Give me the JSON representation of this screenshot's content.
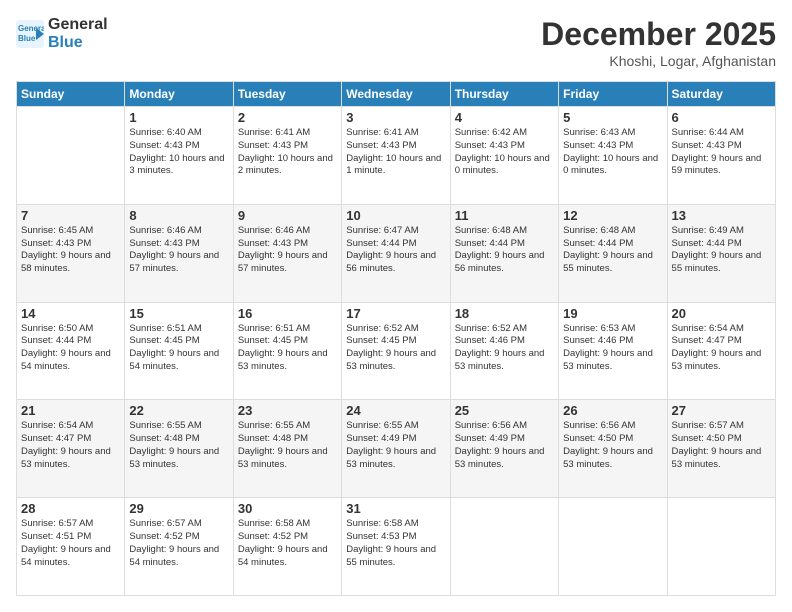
{
  "header": {
    "logo_line1": "General",
    "logo_line2": "Blue",
    "month_title": "December 2025",
    "location": "Khoshi, Logar, Afghanistan"
  },
  "days_of_week": [
    "Sunday",
    "Monday",
    "Tuesday",
    "Wednesday",
    "Thursday",
    "Friday",
    "Saturday"
  ],
  "weeks": [
    [
      {
        "day": "",
        "sunrise": "",
        "sunset": "",
        "daylight": ""
      },
      {
        "day": "1",
        "sunrise": "6:40 AM",
        "sunset": "4:43 PM",
        "daylight": "10 hours and 3 minutes."
      },
      {
        "day": "2",
        "sunrise": "6:41 AM",
        "sunset": "4:43 PM",
        "daylight": "10 hours and 2 minutes."
      },
      {
        "day": "3",
        "sunrise": "6:41 AM",
        "sunset": "4:43 PM",
        "daylight": "10 hours and 1 minute."
      },
      {
        "day": "4",
        "sunrise": "6:42 AM",
        "sunset": "4:43 PM",
        "daylight": "10 hours and 0 minutes."
      },
      {
        "day": "5",
        "sunrise": "6:43 AM",
        "sunset": "4:43 PM",
        "daylight": "10 hours and 0 minutes."
      },
      {
        "day": "6",
        "sunrise": "6:44 AM",
        "sunset": "4:43 PM",
        "daylight": "9 hours and 59 minutes."
      }
    ],
    [
      {
        "day": "7",
        "sunrise": "6:45 AM",
        "sunset": "4:43 PM",
        "daylight": "9 hours and 58 minutes."
      },
      {
        "day": "8",
        "sunrise": "6:46 AM",
        "sunset": "4:43 PM",
        "daylight": "9 hours and 57 minutes."
      },
      {
        "day": "9",
        "sunrise": "6:46 AM",
        "sunset": "4:43 PM",
        "daylight": "9 hours and 57 minutes."
      },
      {
        "day": "10",
        "sunrise": "6:47 AM",
        "sunset": "4:44 PM",
        "daylight": "9 hours and 56 minutes."
      },
      {
        "day": "11",
        "sunrise": "6:48 AM",
        "sunset": "4:44 PM",
        "daylight": "9 hours and 56 minutes."
      },
      {
        "day": "12",
        "sunrise": "6:48 AM",
        "sunset": "4:44 PM",
        "daylight": "9 hours and 55 minutes."
      },
      {
        "day": "13",
        "sunrise": "6:49 AM",
        "sunset": "4:44 PM",
        "daylight": "9 hours and 55 minutes."
      }
    ],
    [
      {
        "day": "14",
        "sunrise": "6:50 AM",
        "sunset": "4:44 PM",
        "daylight": "9 hours and 54 minutes."
      },
      {
        "day": "15",
        "sunrise": "6:51 AM",
        "sunset": "4:45 PM",
        "daylight": "9 hours and 54 minutes."
      },
      {
        "day": "16",
        "sunrise": "6:51 AM",
        "sunset": "4:45 PM",
        "daylight": "9 hours and 53 minutes."
      },
      {
        "day": "17",
        "sunrise": "6:52 AM",
        "sunset": "4:45 PM",
        "daylight": "9 hours and 53 minutes."
      },
      {
        "day": "18",
        "sunrise": "6:52 AM",
        "sunset": "4:46 PM",
        "daylight": "9 hours and 53 minutes."
      },
      {
        "day": "19",
        "sunrise": "6:53 AM",
        "sunset": "4:46 PM",
        "daylight": "9 hours and 53 minutes."
      },
      {
        "day": "20",
        "sunrise": "6:54 AM",
        "sunset": "4:47 PM",
        "daylight": "9 hours and 53 minutes."
      }
    ],
    [
      {
        "day": "21",
        "sunrise": "6:54 AM",
        "sunset": "4:47 PM",
        "daylight": "9 hours and 53 minutes."
      },
      {
        "day": "22",
        "sunrise": "6:55 AM",
        "sunset": "4:48 PM",
        "daylight": "9 hours and 53 minutes."
      },
      {
        "day": "23",
        "sunrise": "6:55 AM",
        "sunset": "4:48 PM",
        "daylight": "9 hours and 53 minutes."
      },
      {
        "day": "24",
        "sunrise": "6:55 AM",
        "sunset": "4:49 PM",
        "daylight": "9 hours and 53 minutes."
      },
      {
        "day": "25",
        "sunrise": "6:56 AM",
        "sunset": "4:49 PM",
        "daylight": "9 hours and 53 minutes."
      },
      {
        "day": "26",
        "sunrise": "6:56 AM",
        "sunset": "4:50 PM",
        "daylight": "9 hours and 53 minutes."
      },
      {
        "day": "27",
        "sunrise": "6:57 AM",
        "sunset": "4:50 PM",
        "daylight": "9 hours and 53 minutes."
      }
    ],
    [
      {
        "day": "28",
        "sunrise": "6:57 AM",
        "sunset": "4:51 PM",
        "daylight": "9 hours and 54 minutes."
      },
      {
        "day": "29",
        "sunrise": "6:57 AM",
        "sunset": "4:52 PM",
        "daylight": "9 hours and 54 minutes."
      },
      {
        "day": "30",
        "sunrise": "6:58 AM",
        "sunset": "4:52 PM",
        "daylight": "9 hours and 54 minutes."
      },
      {
        "day": "31",
        "sunrise": "6:58 AM",
        "sunset": "4:53 PM",
        "daylight": "9 hours and 55 minutes."
      },
      {
        "day": "",
        "sunrise": "",
        "sunset": "",
        "daylight": ""
      },
      {
        "day": "",
        "sunrise": "",
        "sunset": "",
        "daylight": ""
      },
      {
        "day": "",
        "sunrise": "",
        "sunset": "",
        "daylight": ""
      }
    ]
  ]
}
